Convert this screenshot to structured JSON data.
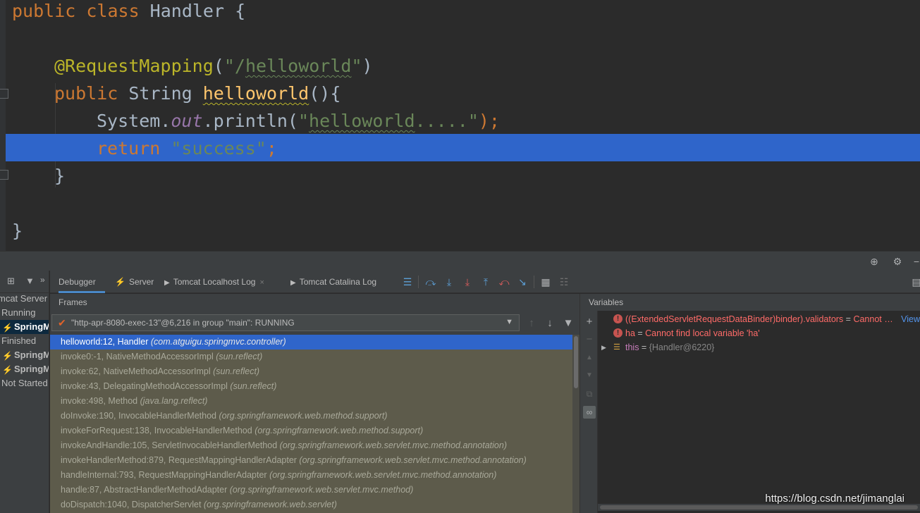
{
  "editor": {
    "lines": {
      "l1": {
        "kw": "public class ",
        "name": "Handler",
        "brace": " {"
      },
      "l3": {
        "annotation": "@RequestMapping",
        "paren_open": "(",
        "str_a": "\"/",
        "str_b": "helloworld",
        "str_c": "\"",
        "paren_close": ")"
      },
      "l4": {
        "kw": "public ",
        "type": "String ",
        "method": "helloworld",
        "rest": "(){"
      },
      "l5": {
        "cls": "System.",
        "field": "out",
        "call": ".println(",
        "str_a": "\"",
        "str_b": "helloworld",
        "str_c": ".....\"",
        "end": ");"
      },
      "l6": {
        "kw": "return ",
        "str": "\"success\"",
        "semi": ";"
      },
      "l7": {
        "brace": "}"
      },
      "l9": {
        "brace": "}"
      }
    }
  },
  "services": {
    "rows": [
      "mcat Server",
      "Running",
      "SpringM",
      "Finished",
      "SpringM",
      "SpringM",
      "Not Started"
    ]
  },
  "tabs": {
    "debugger": "Debugger",
    "server": "Server",
    "localhost_log": "Tomcat Localhost Log",
    "catalina_log": "Tomcat Catalina Log",
    "close": "×"
  },
  "frames": {
    "title": "Frames",
    "thread": "\"http-apr-8080-exec-13\"@6,216 in group \"main\": RUNNING",
    "items": [
      {
        "name": "helloworld:12, Handler",
        "pkg": "(com.atguigu.springmvc.controller)"
      },
      {
        "name": "invoke0:-1, NativeMethodAccessorImpl",
        "pkg": "(sun.reflect)"
      },
      {
        "name": "invoke:62, NativeMethodAccessorImpl",
        "pkg": "(sun.reflect)"
      },
      {
        "name": "invoke:43, DelegatingMethodAccessorImpl",
        "pkg": "(sun.reflect)"
      },
      {
        "name": "invoke:498, Method",
        "pkg": "(java.lang.reflect)"
      },
      {
        "name": "doInvoke:190, InvocableHandlerMethod",
        "pkg": "(org.springframework.web.method.support)"
      },
      {
        "name": "invokeForRequest:138, InvocableHandlerMethod",
        "pkg": "(org.springframework.web.method.support)"
      },
      {
        "name": "invokeAndHandle:105, ServletInvocableHandlerMethod",
        "pkg": "(org.springframework.web.servlet.mvc.method.annotation)"
      },
      {
        "name": "invokeHandlerMethod:879, RequestMappingHandlerAdapter",
        "pkg": "(org.springframework.web.servlet.mvc.method.annotation)"
      },
      {
        "name": "handleInternal:793, RequestMappingHandlerAdapter",
        "pkg": "(org.springframework.web.servlet.mvc.method.annotation)"
      },
      {
        "name": "handle:87, AbstractHandlerMethodAdapter",
        "pkg": "(org.springframework.web.servlet.mvc.method)"
      },
      {
        "name": "doDispatch:1040, DispatcherServlet",
        "pkg": "(org.springframework.web.servlet)"
      }
    ]
  },
  "variables": {
    "title": "Variables",
    "rows": {
      "r1": {
        "text": "((ExtendedServletRequestDataBinder)binder).validators",
        "eq": " = ",
        "msg": "Cannot …",
        "link": "View"
      },
      "r2": {
        "name": "ha",
        "eq": " = ",
        "msg": "Cannot find local variable 'ha'"
      },
      "r3": {
        "name": "this",
        "eq": " = ",
        "value": "{Handler@6220}"
      }
    }
  },
  "watermark": "https://blog.csdn.net/jimanglai"
}
